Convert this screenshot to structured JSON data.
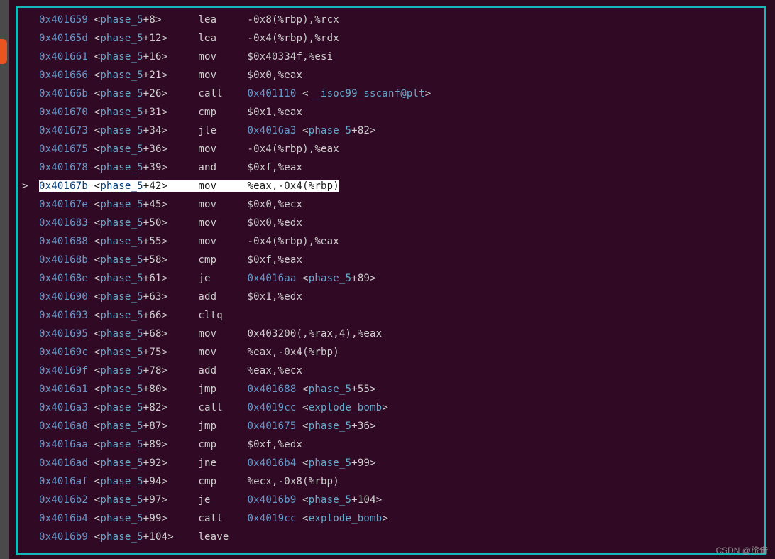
{
  "watermark": "CSDN @旅借",
  "colors": {
    "accent": "#14b8b8",
    "bg": "#300a24",
    "addr": "#6699cc",
    "func": "#66aacc"
  },
  "lines": [
    {
      "addr": "0x401659",
      "func": "phase_5",
      "off": "8",
      "mnem": "lea",
      "operands": "-0x8(%rbp),%rcx",
      "jump": null,
      "highlight": false,
      "prompt": ""
    },
    {
      "addr": "0x40165d",
      "func": "phase_5",
      "off": "12",
      "mnem": "lea",
      "operands": "-0x4(%rbp),%rdx",
      "jump": null,
      "highlight": false,
      "prompt": ""
    },
    {
      "addr": "0x401661",
      "func": "phase_5",
      "off": "16",
      "mnem": "mov",
      "operands": "$0x40334f,%esi",
      "jump": null,
      "highlight": false,
      "prompt": ""
    },
    {
      "addr": "0x401666",
      "func": "phase_5",
      "off": "21",
      "mnem": "mov",
      "operands": "$0x0,%eax",
      "jump": null,
      "highlight": false,
      "prompt": ""
    },
    {
      "addr": "0x40166b",
      "func": "phase_5",
      "off": "26",
      "mnem": "call",
      "operands": null,
      "jump": {
        "addr": "0x401110",
        "func": "__isoc99_sscanf@plt",
        "off": null
      },
      "highlight": false,
      "prompt": ""
    },
    {
      "addr": "0x401670",
      "func": "phase_5",
      "off": "31",
      "mnem": "cmp",
      "operands": "$0x1,%eax",
      "jump": null,
      "highlight": false,
      "prompt": ""
    },
    {
      "addr": "0x401673",
      "func": "phase_5",
      "off": "34",
      "mnem": "jle",
      "operands": null,
      "jump": {
        "addr": "0x4016a3",
        "func": "phase_5",
        "off": "82"
      },
      "highlight": false,
      "prompt": ""
    },
    {
      "addr": "0x401675",
      "func": "phase_5",
      "off": "36",
      "mnem": "mov",
      "operands": "-0x4(%rbp),%eax",
      "jump": null,
      "highlight": false,
      "prompt": ""
    },
    {
      "addr": "0x401678",
      "func": "phase_5",
      "off": "39",
      "mnem": "and",
      "operands": "$0xf,%eax",
      "jump": null,
      "highlight": false,
      "prompt": ""
    },
    {
      "addr": "0x40167b",
      "func": "phase_5",
      "off": "42",
      "mnem": "mov",
      "operands": "%eax,-0x4(%rbp)",
      "jump": null,
      "highlight": true,
      "prompt": ">"
    },
    {
      "addr": "0x40167e",
      "func": "phase_5",
      "off": "45",
      "mnem": "mov",
      "operands": "$0x0,%ecx",
      "jump": null,
      "highlight": false,
      "prompt": ""
    },
    {
      "addr": "0x401683",
      "func": "phase_5",
      "off": "50",
      "mnem": "mov",
      "operands": "$0x0,%edx",
      "jump": null,
      "highlight": false,
      "prompt": ""
    },
    {
      "addr": "0x401688",
      "func": "phase_5",
      "off": "55",
      "mnem": "mov",
      "operands": "-0x4(%rbp),%eax",
      "jump": null,
      "highlight": false,
      "prompt": ""
    },
    {
      "addr": "0x40168b",
      "func": "phase_5",
      "off": "58",
      "mnem": "cmp",
      "operands": "$0xf,%eax",
      "jump": null,
      "highlight": false,
      "prompt": ""
    },
    {
      "addr": "0x40168e",
      "func": "phase_5",
      "off": "61",
      "mnem": "je",
      "operands": null,
      "jump": {
        "addr": "0x4016aa",
        "func": "phase_5",
        "off": "89"
      },
      "highlight": false,
      "prompt": ""
    },
    {
      "addr": "0x401690",
      "func": "phase_5",
      "off": "63",
      "mnem": "add",
      "operands": "$0x1,%edx",
      "jump": null,
      "highlight": false,
      "prompt": ""
    },
    {
      "addr": "0x401693",
      "func": "phase_5",
      "off": "66",
      "mnem": "cltq",
      "operands": "",
      "jump": null,
      "highlight": false,
      "prompt": ""
    },
    {
      "addr": "0x401695",
      "func": "phase_5",
      "off": "68",
      "mnem": "mov",
      "operands": "0x403200(,%rax,4),%eax",
      "jump": null,
      "highlight": false,
      "prompt": ""
    },
    {
      "addr": "0x40169c",
      "func": "phase_5",
      "off": "75",
      "mnem": "mov",
      "operands": "%eax,-0x4(%rbp)",
      "jump": null,
      "highlight": false,
      "prompt": ""
    },
    {
      "addr": "0x40169f",
      "func": "phase_5",
      "off": "78",
      "mnem": "add",
      "operands": "%eax,%ecx",
      "jump": null,
      "highlight": false,
      "prompt": ""
    },
    {
      "addr": "0x4016a1",
      "func": "phase_5",
      "off": "80",
      "mnem": "jmp",
      "operands": null,
      "jump": {
        "addr": "0x401688",
        "func": "phase_5",
        "off": "55"
      },
      "highlight": false,
      "prompt": ""
    },
    {
      "addr": "0x4016a3",
      "func": "phase_5",
      "off": "82",
      "mnem": "call",
      "operands": null,
      "jump": {
        "addr": "0x4019cc",
        "func": "explode_bomb",
        "off": null
      },
      "highlight": false,
      "prompt": ""
    },
    {
      "addr": "0x4016a8",
      "func": "phase_5",
      "off": "87",
      "mnem": "jmp",
      "operands": null,
      "jump": {
        "addr": "0x401675",
        "func": "phase_5",
        "off": "36"
      },
      "highlight": false,
      "prompt": ""
    },
    {
      "addr": "0x4016aa",
      "func": "phase_5",
      "off": "89",
      "mnem": "cmp",
      "operands": "$0xf,%edx",
      "jump": null,
      "highlight": false,
      "prompt": ""
    },
    {
      "addr": "0x4016ad",
      "func": "phase_5",
      "off": "92",
      "mnem": "jne",
      "operands": null,
      "jump": {
        "addr": "0x4016b4",
        "func": "phase_5",
        "off": "99"
      },
      "highlight": false,
      "prompt": ""
    },
    {
      "addr": "0x4016af",
      "func": "phase_5",
      "off": "94",
      "mnem": "cmp",
      "operands": "%ecx,-0x8(%rbp)",
      "jump": null,
      "highlight": false,
      "prompt": ""
    },
    {
      "addr": "0x4016b2",
      "func": "phase_5",
      "off": "97",
      "mnem": "je",
      "operands": null,
      "jump": {
        "addr": "0x4016b9",
        "func": "phase_5",
        "off": "104"
      },
      "highlight": false,
      "prompt": ""
    },
    {
      "addr": "0x4016b4",
      "func": "phase_5",
      "off": "99",
      "mnem": "call",
      "operands": null,
      "jump": {
        "addr": "0x4019cc",
        "func": "explode_bomb",
        "off": null
      },
      "highlight": false,
      "prompt": ""
    },
    {
      "addr": "0x4016b9",
      "func": "phase_5",
      "off": "104",
      "mnem": "leave",
      "operands": "",
      "jump": null,
      "highlight": false,
      "prompt": ""
    }
  ],
  "mnem_col": 8,
  "oper_col": 8
}
